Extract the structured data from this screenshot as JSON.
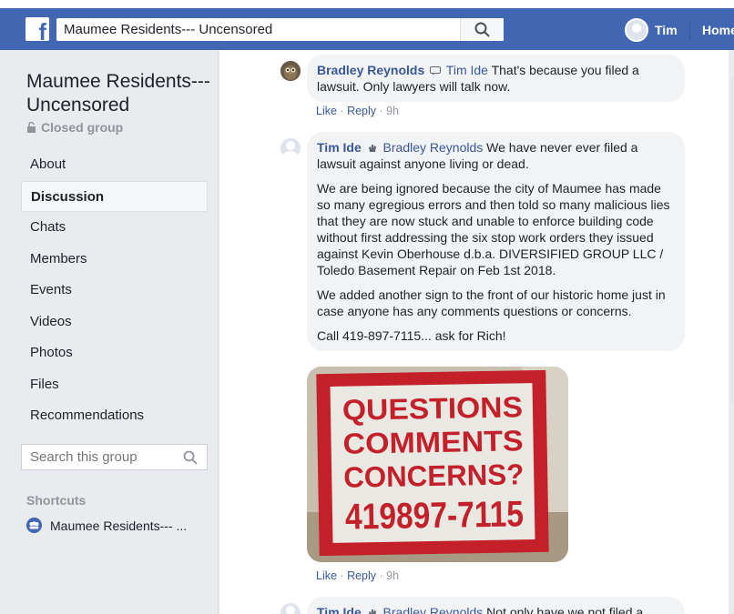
{
  "topbar": {
    "search_value": "Maumee Residents--- Uncensored",
    "user_name": "Tim",
    "home_label": "Home",
    "brand_color": "#4267b2",
    "logo_icon": "facebook-f-icon"
  },
  "sidebar": {
    "group_title": "Maumee Residents--- Uncensored",
    "group_type": "Closed group",
    "nav_items": [
      {
        "label": "About"
      },
      {
        "label": "Discussion",
        "active": true
      },
      {
        "label": "Chats"
      },
      {
        "label": "Members"
      },
      {
        "label": "Events"
      },
      {
        "label": "Videos"
      },
      {
        "label": "Photos"
      },
      {
        "label": "Files"
      },
      {
        "label": "Recommendations"
      }
    ],
    "search_placeholder": "Search this group",
    "shortcuts_header": "Shortcuts",
    "shortcut_item": "Maumee Residents--- ..."
  },
  "feed": {
    "comments": [
      {
        "author": "Bradley Reynolds",
        "reply_to": "Tim Ide",
        "text": "That's because you filed a lawsuit. Only lawyers will talk now.",
        "like": "Like",
        "reply": "Reply",
        "time": "9h"
      },
      {
        "author": "Tim Ide",
        "reply_to": "Bradley Reynolds",
        "paragraphs": [
          "We have never ever filed a lawsuit against anyone living or dead.",
          "We are being ignored because the city of Maumee has made so many egregious errors and then told so many malicious lies that they are now stuck and unable to enforce building code without first addressing the six stop work orders they issued against Kevin Oberhouse d.b.a. DIVERSIFIED GROUP LLC / Toledo Basement Repair on Feb 1st 2018.",
          "We added another sign to the front of our historic home just in case anyone has any comments questions or concerns.",
          "Call 419-897-7115... ask for Rich!"
        ],
        "photo_text": [
          "QUESTIONS",
          "COMMENTS",
          "CONCERNS?",
          "419897-7115"
        ],
        "like": "Like",
        "reply": "Reply",
        "time": "9h"
      },
      {
        "author": "Tim Ide",
        "reply_to": "Bradley Reynolds",
        "text": "Not only have we not filed a"
      }
    ]
  }
}
